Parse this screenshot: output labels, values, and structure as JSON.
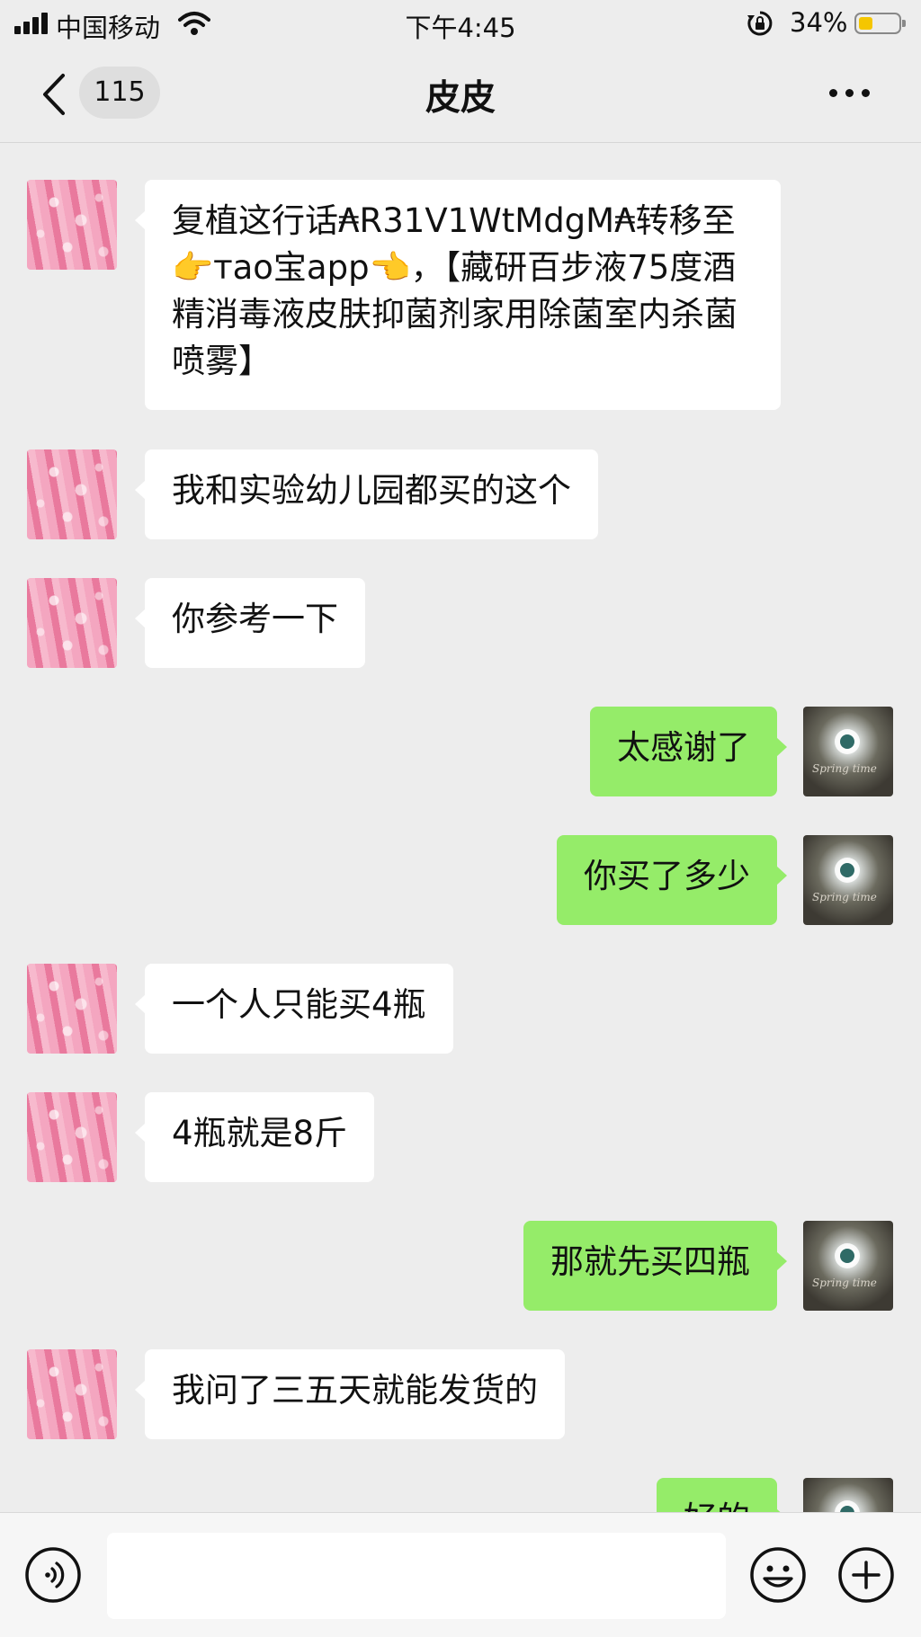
{
  "status_bar": {
    "carrier": "中国移动",
    "time": "下午4:45",
    "battery_percent": "34%",
    "battery_level": 0.34,
    "battery_color": "#f5c600"
  },
  "nav": {
    "unread_count": "115",
    "title": "皮皮",
    "back_icon": "chevron-left-icon",
    "more_icon": "ellipsis-icon"
  },
  "messages": [
    {
      "side": "left",
      "text": "复植这行话₳R31V1WtMdgM₳转移至👉тao宝app👈，【藏研百步液75度酒精消毒液皮肤抑菌剂家用除菌室内杀菌喷雾】"
    },
    {
      "side": "left",
      "text": "我和实验幼儿园都买的这个"
    },
    {
      "side": "left",
      "text": "你参考一下"
    },
    {
      "side": "right",
      "text": "太感谢了"
    },
    {
      "side": "right",
      "text": "你买了多少"
    },
    {
      "side": "left",
      "text": "一个人只能买4瓶"
    },
    {
      "side": "left",
      "text": "4瓶就是8斤"
    },
    {
      "side": "right",
      "text": "那就先买四瓶"
    },
    {
      "side": "left",
      "text": "我问了三五天就能发货的"
    },
    {
      "side": "right",
      "text": "好的"
    }
  ],
  "my_avatar_caption": "Spring time",
  "input_bar": {
    "input_value": "",
    "voice_icon": "voice-icon",
    "emoji_icon": "emoji-icon",
    "plus_icon": "plus-icon"
  },
  "colors": {
    "background": "#ededed",
    "incoming_bubble": "#ffffff",
    "outgoing_bubble": "#95ec69"
  }
}
